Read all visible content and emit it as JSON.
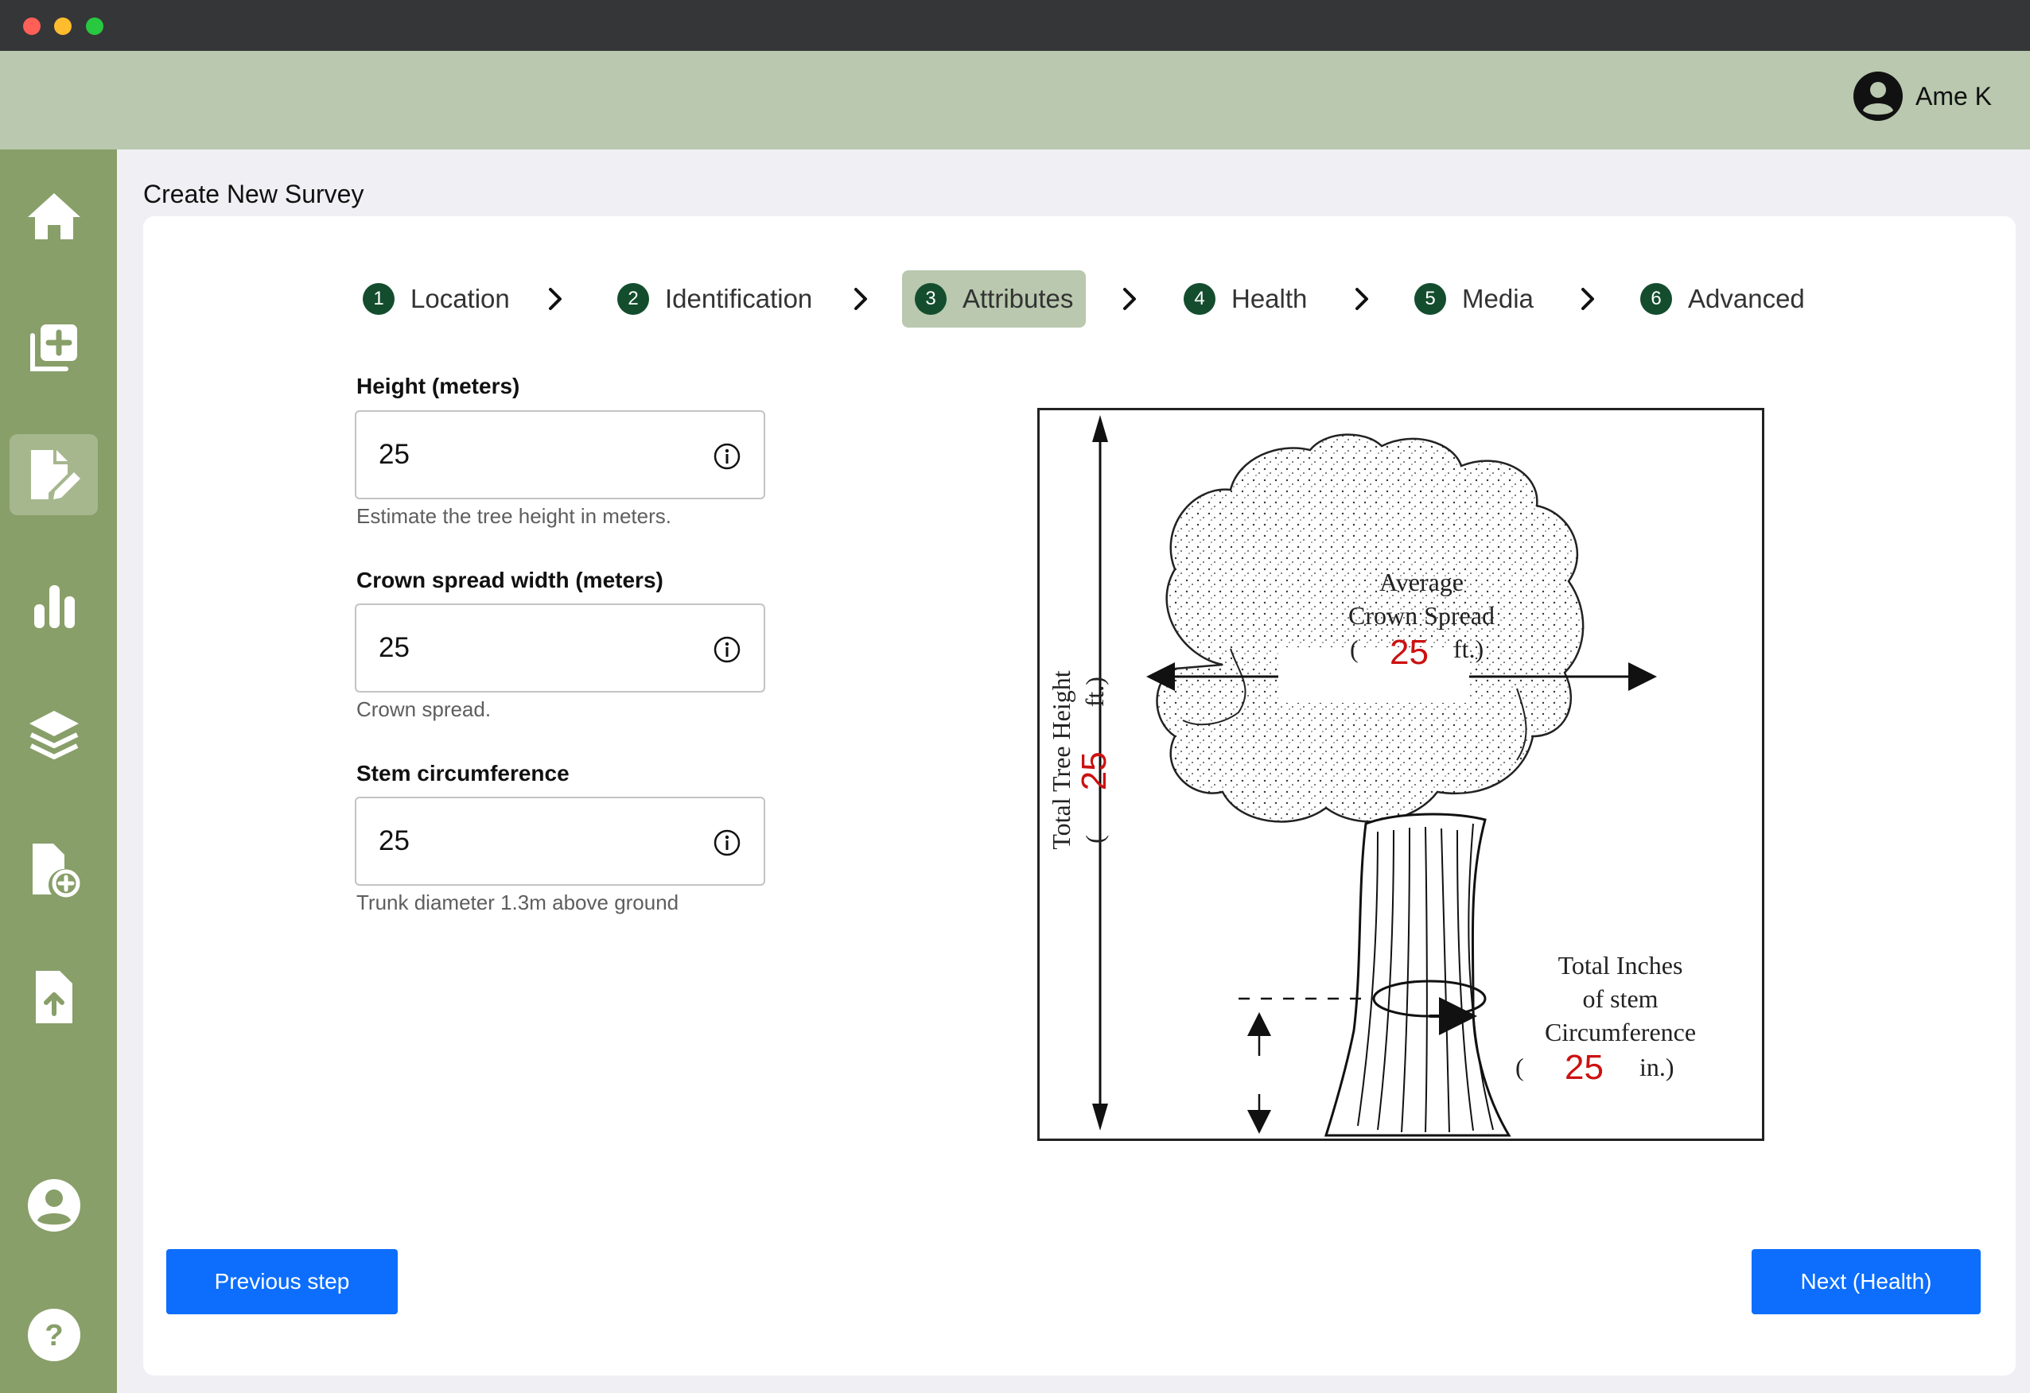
{
  "user": {
    "name": "Ame K"
  },
  "page": {
    "title": "Create New Survey"
  },
  "sidebar": {
    "items": [
      {
        "name": "home",
        "icon": "home-icon"
      },
      {
        "name": "add-survey",
        "icon": "copy-plus-icon"
      },
      {
        "name": "edit-survey",
        "icon": "file-pen-icon",
        "active": true
      },
      {
        "name": "statistics",
        "icon": "bar-chart-icon"
      },
      {
        "name": "layers",
        "icon": "layers-icon"
      },
      {
        "name": "new-file",
        "icon": "file-plus-icon"
      },
      {
        "name": "upload",
        "icon": "file-upload-icon"
      },
      {
        "name": "profile",
        "icon": "user-circle-icon"
      },
      {
        "name": "help",
        "icon": "help-circle-icon"
      }
    ]
  },
  "steps": [
    {
      "num": "1",
      "label": "Location"
    },
    {
      "num": "2",
      "label": "Identification"
    },
    {
      "num": "3",
      "label": "Attributes",
      "active": true
    },
    {
      "num": "4",
      "label": "Health"
    },
    {
      "num": "5",
      "label": "Media"
    },
    {
      "num": "6",
      "label": "Advanced"
    }
  ],
  "fields": {
    "height": {
      "label": "Height (meters)",
      "value": "25",
      "help": "Estimate the tree height in meters."
    },
    "crown": {
      "label": "Crown spread width (meters)",
      "value": "25",
      "help": "Crown spread."
    },
    "stem": {
      "label": "Stem circumference",
      "value": "25",
      "help": "Trunk diameter 1.3m above ground"
    }
  },
  "diagram": {
    "crown_title_1": "Average",
    "crown_title_2": "Crown Spread",
    "crown_open": "(",
    "crown_value": "25",
    "crown_unit": "ft.)",
    "height_title": "Total Tree Height",
    "height_open": "(",
    "height_value": "25",
    "height_unit": "ft.)",
    "stem_title_1": "Total Inches",
    "stem_title_2": "of stem",
    "stem_title_3": "Circumference",
    "stem_open": "(",
    "stem_value": "25",
    "stem_unit": "in.)",
    "value_color": "#cc1111"
  },
  "buttons": {
    "previous": "Previous step",
    "next": "Next (Health)"
  },
  "colors": {
    "sidebar": "#889f69",
    "topbar": "#b9c8ae",
    "step_badge": "#144d2e",
    "primary": "#0d6efd"
  }
}
